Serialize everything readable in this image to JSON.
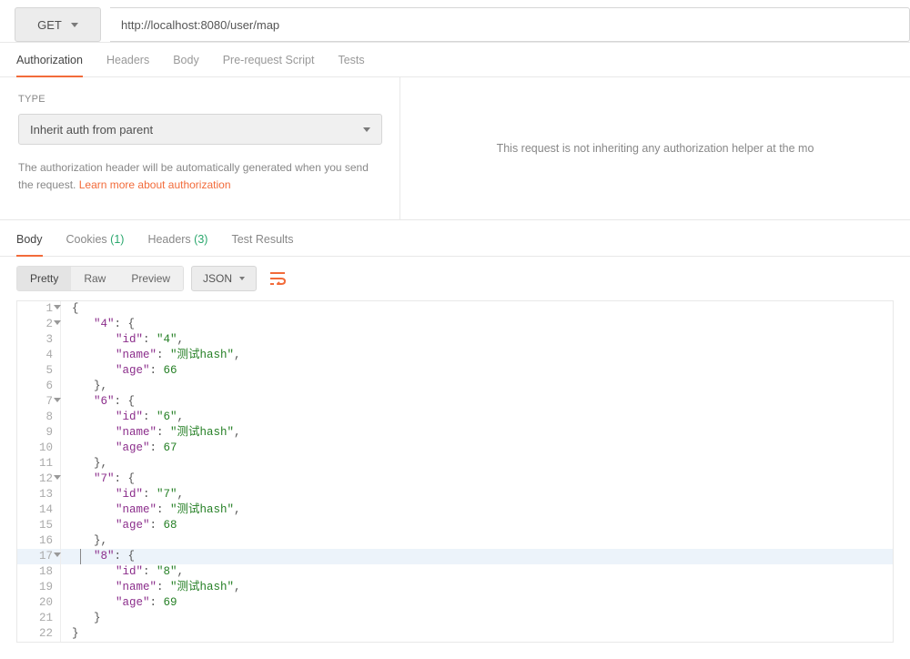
{
  "method": "GET",
  "url": "http://localhost:8080/user/map",
  "request_tabs": {
    "authorization": "Authorization",
    "headers": "Headers",
    "body": "Body",
    "prerequest": "Pre-request Script",
    "tests": "Tests"
  },
  "auth": {
    "type_label": "TYPE",
    "selected": "Inherit auth from parent",
    "description_prefix": "The authorization header will be automatically generated when you send the request. ",
    "learn_more": "Learn more about authorization",
    "right_message": "This request is not inheriting any authorization helper at the mo"
  },
  "response_tabs": {
    "body": "Body",
    "cookies": "Cookies",
    "cookies_count": "(1)",
    "headers": "Headers",
    "headers_count": "(3)",
    "test_results": "Test Results"
  },
  "toolbar": {
    "pretty": "Pretty",
    "raw": "Raw",
    "preview": "Preview",
    "format": "JSON"
  },
  "code": {
    "lines": [
      {
        "n": "1",
        "fold": true,
        "indent": 0,
        "tokens": [
          [
            "punc",
            "{"
          ]
        ]
      },
      {
        "n": "2",
        "fold": true,
        "indent": 1,
        "tokens": [
          [
            "key",
            "\"4\""
          ],
          [
            "punc",
            ": {"
          ]
        ]
      },
      {
        "n": "3",
        "indent": 2,
        "tokens": [
          [
            "key",
            "\"id\""
          ],
          [
            "punc",
            ": "
          ],
          [
            "str",
            "\"4\""
          ],
          [
            "punc",
            ","
          ]
        ]
      },
      {
        "n": "4",
        "indent": 2,
        "tokens": [
          [
            "key",
            "\"name\""
          ],
          [
            "punc",
            ": "
          ],
          [
            "str",
            "\"测试hash\""
          ],
          [
            "punc",
            ","
          ]
        ]
      },
      {
        "n": "5",
        "indent": 2,
        "tokens": [
          [
            "key",
            "\"age\""
          ],
          [
            "punc",
            ": "
          ],
          [
            "num",
            "66"
          ]
        ]
      },
      {
        "n": "6",
        "indent": 1,
        "tokens": [
          [
            "punc",
            "},"
          ]
        ]
      },
      {
        "n": "7",
        "fold": true,
        "indent": 1,
        "tokens": [
          [
            "key",
            "\"6\""
          ],
          [
            "punc",
            ": {"
          ]
        ]
      },
      {
        "n": "8",
        "indent": 2,
        "tokens": [
          [
            "key",
            "\"id\""
          ],
          [
            "punc",
            ": "
          ],
          [
            "str",
            "\"6\""
          ],
          [
            "punc",
            ","
          ]
        ]
      },
      {
        "n": "9",
        "indent": 2,
        "tokens": [
          [
            "key",
            "\"name\""
          ],
          [
            "punc",
            ": "
          ],
          [
            "str",
            "\"测试hash\""
          ],
          [
            "punc",
            ","
          ]
        ]
      },
      {
        "n": "10",
        "indent": 2,
        "tokens": [
          [
            "key",
            "\"age\""
          ],
          [
            "punc",
            ": "
          ],
          [
            "num",
            "67"
          ]
        ]
      },
      {
        "n": "11",
        "indent": 1,
        "tokens": [
          [
            "punc",
            "},"
          ]
        ]
      },
      {
        "n": "12",
        "fold": true,
        "indent": 1,
        "tokens": [
          [
            "key",
            "\"7\""
          ],
          [
            "punc",
            ": {"
          ]
        ]
      },
      {
        "n": "13",
        "indent": 2,
        "tokens": [
          [
            "key",
            "\"id\""
          ],
          [
            "punc",
            ": "
          ],
          [
            "str",
            "\"7\""
          ],
          [
            "punc",
            ","
          ]
        ]
      },
      {
        "n": "14",
        "indent": 2,
        "tokens": [
          [
            "key",
            "\"name\""
          ],
          [
            "punc",
            ": "
          ],
          [
            "str",
            "\"测试hash\""
          ],
          [
            "punc",
            ","
          ]
        ]
      },
      {
        "n": "15",
        "indent": 2,
        "tokens": [
          [
            "key",
            "\"age\""
          ],
          [
            "punc",
            ": "
          ],
          [
            "num",
            "68"
          ]
        ]
      },
      {
        "n": "16",
        "indent": 1,
        "tokens": [
          [
            "punc",
            "},"
          ]
        ]
      },
      {
        "n": "17",
        "fold": true,
        "hl": true,
        "indent": 1,
        "tokens": [
          [
            "key",
            "\"8\""
          ],
          [
            "punc",
            ": {"
          ]
        ]
      },
      {
        "n": "18",
        "indent": 2,
        "tokens": [
          [
            "key",
            "\"id\""
          ],
          [
            "punc",
            ": "
          ],
          [
            "str",
            "\"8\""
          ],
          [
            "punc",
            ","
          ]
        ]
      },
      {
        "n": "19",
        "indent": 2,
        "tokens": [
          [
            "key",
            "\"name\""
          ],
          [
            "punc",
            ": "
          ],
          [
            "str",
            "\"测试hash\""
          ],
          [
            "punc",
            ","
          ]
        ]
      },
      {
        "n": "20",
        "indent": 2,
        "tokens": [
          [
            "key",
            "\"age\""
          ],
          [
            "punc",
            ": "
          ],
          [
            "num",
            "69"
          ]
        ]
      },
      {
        "n": "21",
        "indent": 1,
        "tokens": [
          [
            "punc",
            "}"
          ]
        ]
      },
      {
        "n": "22",
        "indent": 0,
        "tokens": [
          [
            "punc",
            "}"
          ]
        ]
      }
    ]
  }
}
